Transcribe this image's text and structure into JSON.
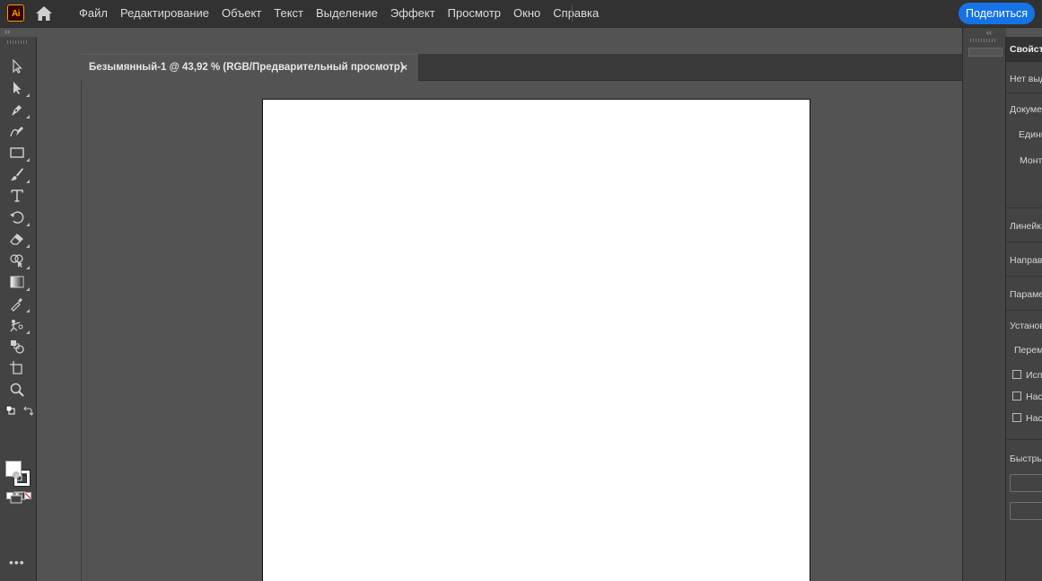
{
  "app": {
    "logo_text": "Ai",
    "share_label": "Поделиться"
  },
  "menu": [
    "Файл",
    "Редактирование",
    "Объект",
    "Текст",
    "Выделение",
    "Эффект",
    "Просмотр",
    "Окно",
    "Справка"
  ],
  "document": {
    "tab_title": "Безымянный-1 @ 43,92 % (RGB/Предварительный просмотр)",
    "close_glyph": "×"
  },
  "toolbar": {
    "collapse_glyph": "››",
    "more_glyph": "•••",
    "tools": [
      "selection-tool",
      "direct-selection-tool",
      "pen-tool",
      "curvature-tool",
      "rectangle-tool",
      "paintbrush-tool",
      "type-tool",
      "rotate-tool",
      "eraser-tool",
      "shape-builder-tool",
      "gradient-tool",
      "eyedropper-tool",
      "puppet-warp-tool",
      "blend-tool",
      "artboard-tool",
      "zoom-tool"
    ],
    "colors": {
      "fill": "#ffffff",
      "stroke": "#000000"
    }
  },
  "properties_panel": {
    "collapse_glyph": "‹‹",
    "title": "Свойств",
    "no_selection": "Нет выд",
    "document_section": "Докумен",
    "units_label": "Едини",
    "artboard_label": "Монта",
    "rulers_section": "Линейка",
    "guides_section": "Направ",
    "params_section": "Парамет",
    "settings_section": "Установ",
    "move_label": "Переме",
    "check_1": "Испо",
    "check_2": "Наст",
    "check_3": "Наст",
    "quick_section": "Быстры"
  },
  "theme": {
    "accent": "#1473e6",
    "logo_border": "#ff9a00",
    "background": "#535353",
    "artboard": "#ffffff"
  }
}
